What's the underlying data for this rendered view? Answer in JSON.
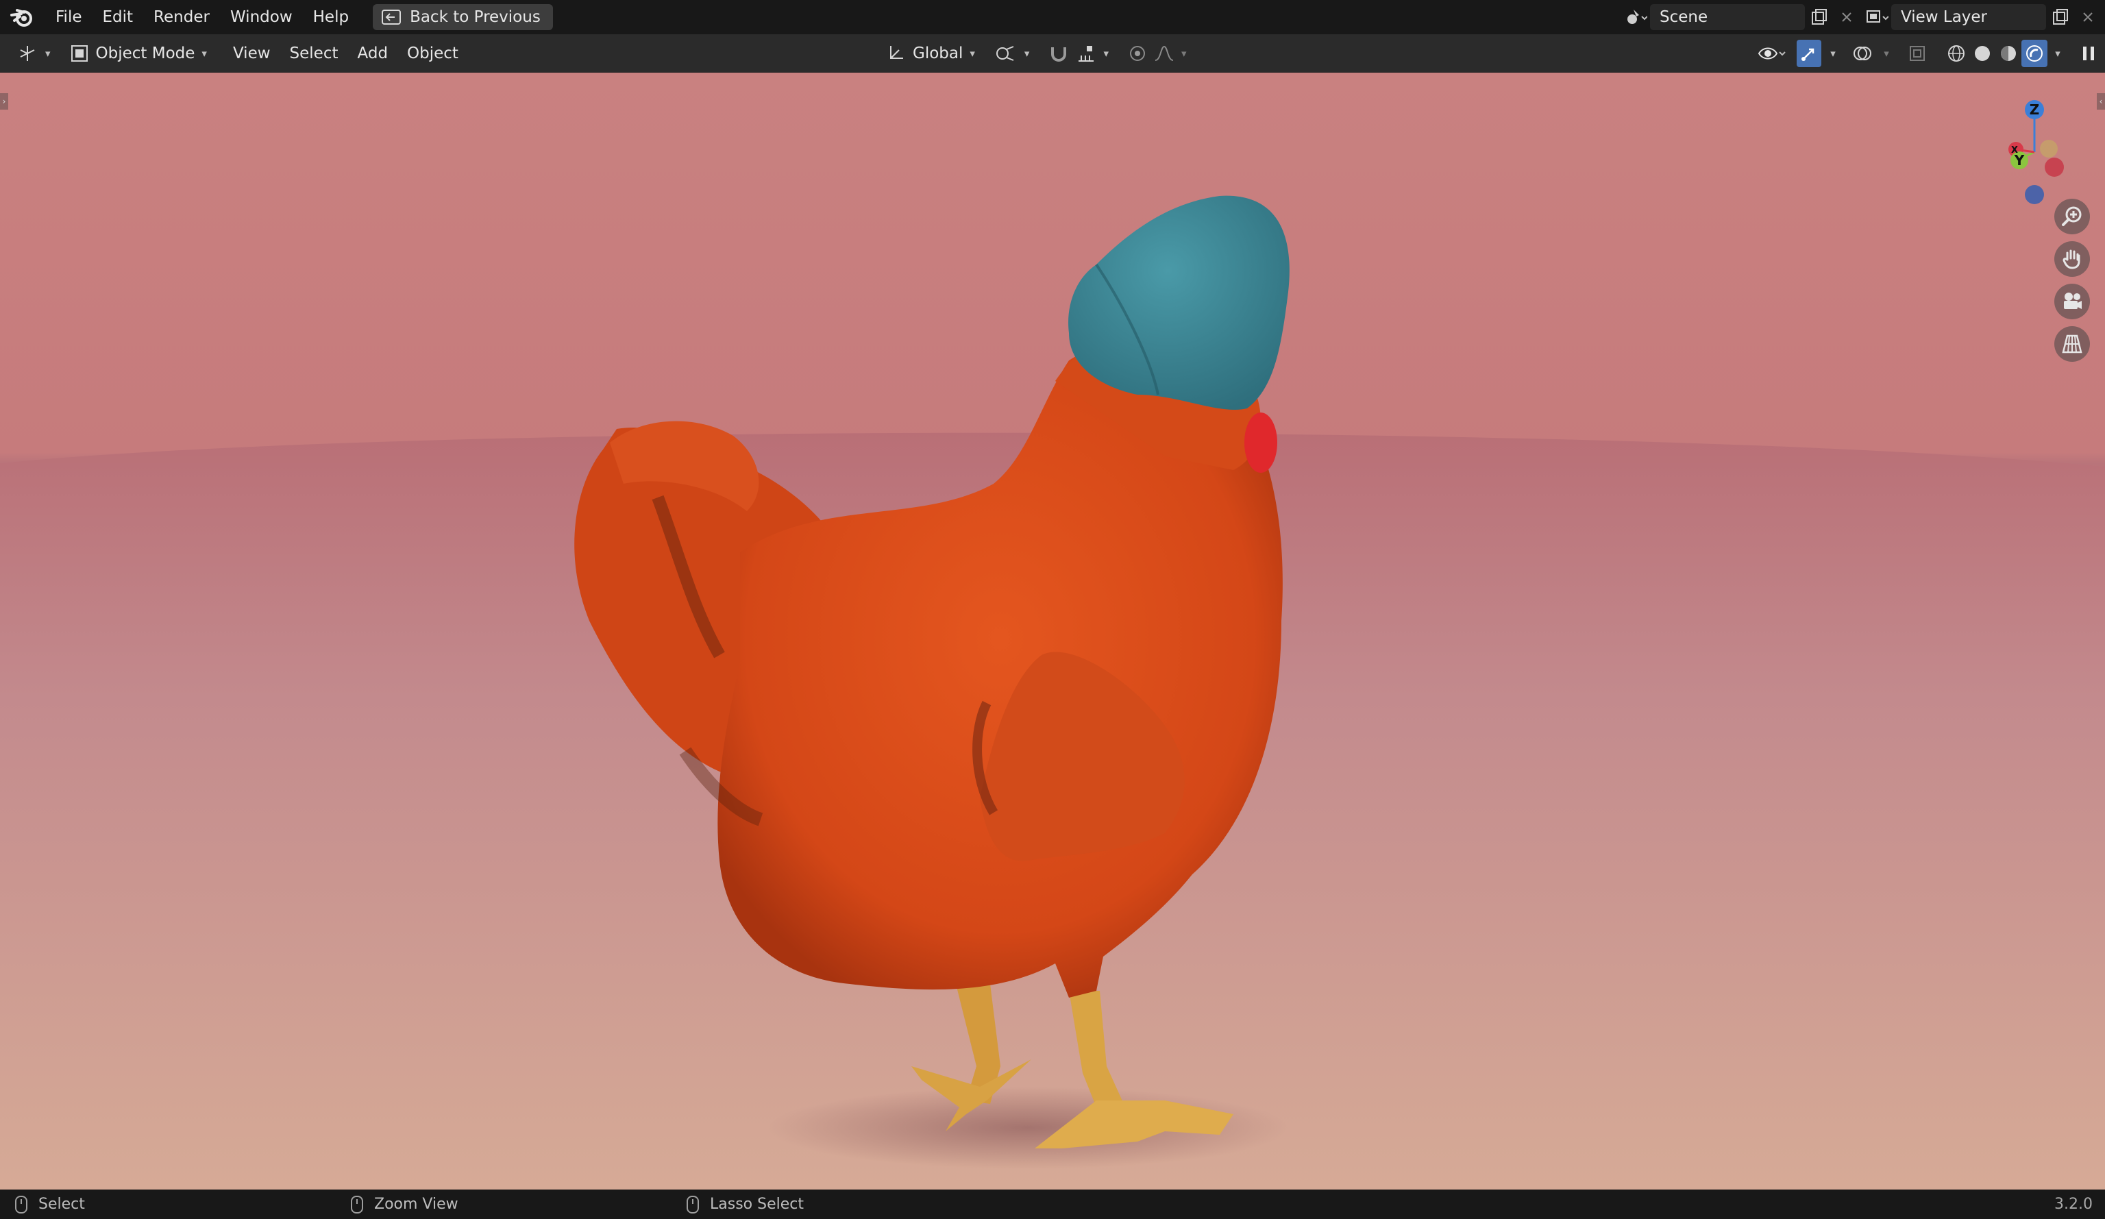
{
  "menubar": {
    "items": [
      "File",
      "Edit",
      "Render",
      "Window",
      "Help"
    ],
    "back_button": "Back to Previous",
    "scene": "Scene",
    "view_layer": "View Layer"
  },
  "header": {
    "mode": "Object Mode",
    "menus": [
      "View",
      "Select",
      "Add",
      "Object"
    ],
    "transform_orientation": "Global"
  },
  "gizmo": {
    "z_label": "Z",
    "y_label": "Y",
    "x_label": "X"
  },
  "statusbar": {
    "left_action": "Select",
    "middle_action": "Zoom View",
    "right_action": "Lasso Select",
    "version": "3.2.0"
  },
  "colors": {
    "accent": "#4772b3",
    "background": "#c98180",
    "chicken": "#d9481a",
    "hat": "#3f8a98",
    "comb": "#e0282c",
    "feet": "#d9a040"
  },
  "icons": {
    "app_logo": "blender-logo-icon",
    "editor_type": "viewport-editor-icon",
    "zoom": "zoom-icon",
    "pan": "hand-icon",
    "camera": "camera-icon",
    "perspective": "grid-icon"
  }
}
